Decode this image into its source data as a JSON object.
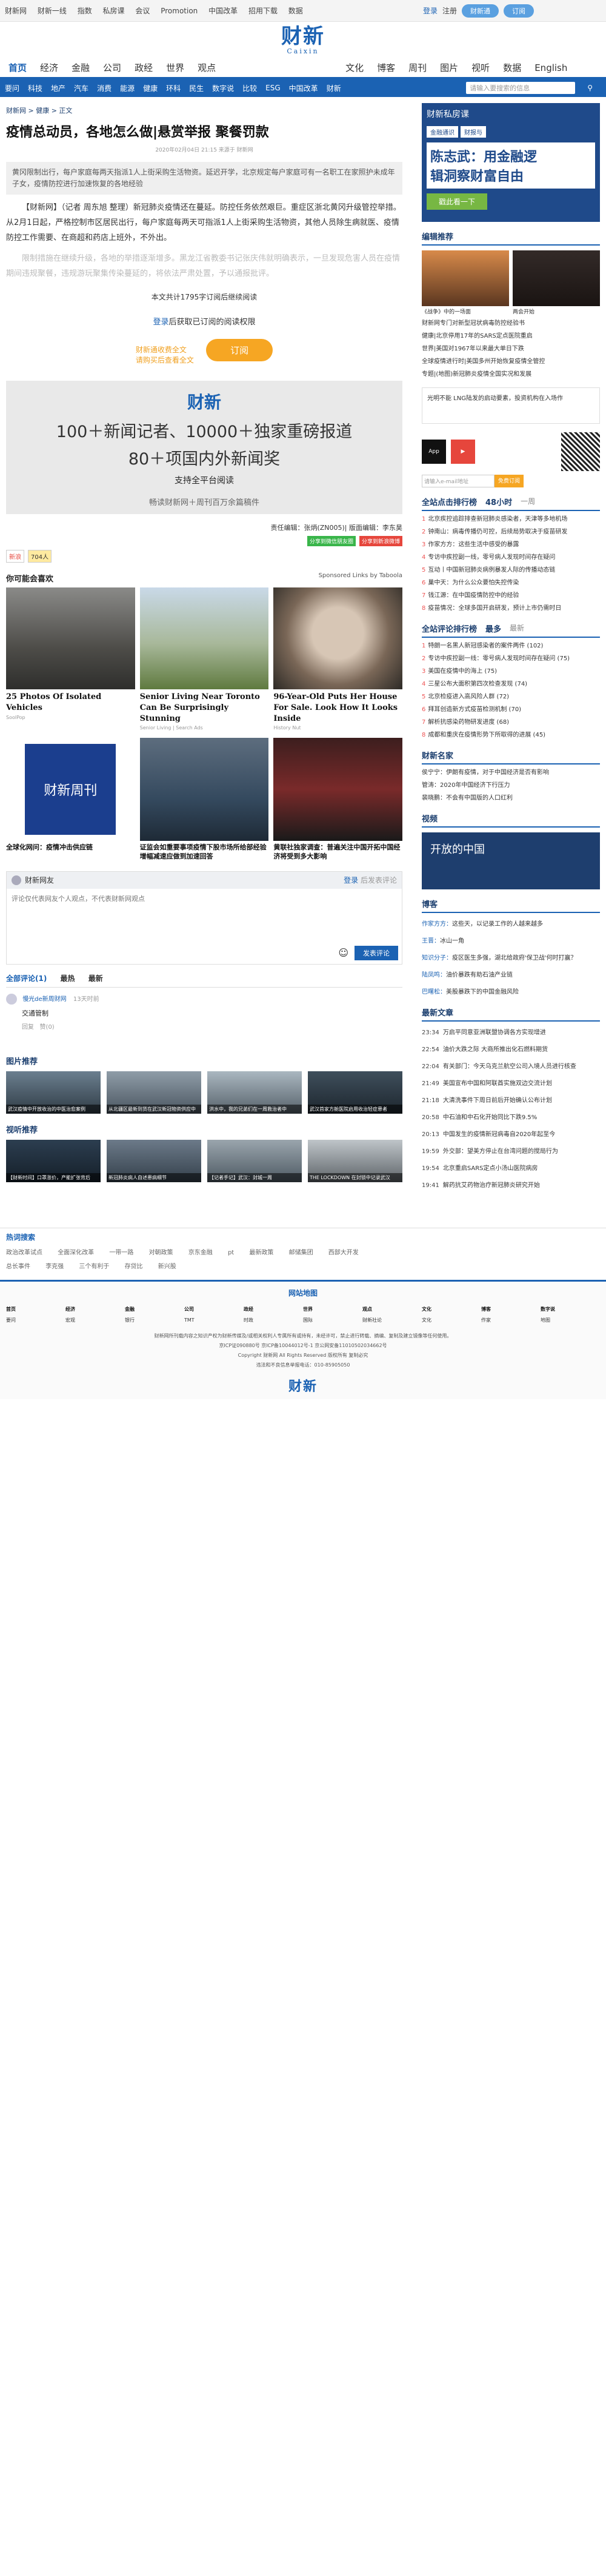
{
  "topbar": {
    "links": [
      "财新网",
      "财新一线",
      "指数",
      "私房课",
      "会议",
      "Promotion",
      "中国改革",
      "招用下载",
      "数据"
    ],
    "login": "登录",
    "register": "注册",
    "pill1": "财新通",
    "pill2": "订阅"
  },
  "logo": {
    "cn": "财新",
    "en": "Caixin"
  },
  "mainnav": {
    "left": [
      "首页",
      "经济",
      "金融",
      "公司",
      "政经",
      "世界",
      "观点"
    ],
    "right": [
      "文化",
      "博客",
      "周刊",
      "图片",
      "视听",
      "数据",
      "English"
    ]
  },
  "subnav": {
    "items": [
      "要问",
      "科技",
      "地产",
      "汽车",
      "消费",
      "能源",
      "健康",
      "环科",
      "民生",
      "数字说",
      "比较",
      "ESG",
      "中国改革",
      "财新"
    ],
    "search": "请输入要搜索的信息"
  },
  "article": {
    "breadcrumb": "财新网 > 健康 > 正文",
    "title": "疫情总动员，各地怎么做|悬赏举报 聚餐罚款",
    "meta": "2020年02月04日 21:15 来源于 财新网",
    "summary": "黄冈限制出行，每户家庭每两天指派1人上街采购生活物资。延迟开学，北京规定每户家庭可有一名职工在家照护未成年子女，疫情防控进行加速恢复的各地经验",
    "p1": "【财新网】（记者 周东旭 整理）新冠肺炎疫情还在蔓延。防控任务依然艰巨。重症区浙北黄冈升级管控举措。从2月1日起，严格控制市区居民出行，每户家庭每两天可指派1人上街采购生活物资，其他人员除生病就医、疫情防控工作需要、在商超和药店上班外，不外出。",
    "p2": "限制措施在继续升级，各地的举措逐渐增多。黑龙江省教委书记张庆伟就明确表示，一旦发现危害人员在疫情期间违规聚餐，违规游玩聚集传染蔓延的，将依法严肃处置，予以通报批评。",
    "note": "本文共计1795字订阅后继续阅读"
  },
  "paywall": {
    "login": "登录",
    "tip": "后获取已订阅的阅读权限",
    "sub1": "财新通收费全文",
    "sub2": "请购买后查看全文",
    "btn": "订阅"
  },
  "banner": {
    "logo": "财新",
    "l1": "100＋新闻记者、10000＋独家重磅报道",
    "l2": "80＋项国内外新闻奖",
    "l3": "支持全平台阅读",
    "l4": "畅读财新网＋周刊百万余篇稿件"
  },
  "editor": "责任编辑：张炳(ZN005)| 版面编辑：李东昊",
  "badges": [
    "分享到微信朋友圈",
    "分享到新浪微博"
  ],
  "share": [
    "新浪",
    "704人"
  ],
  "recommend": {
    "title": "你可能会喜欢",
    "sponsor": "Sponsored Links by Taboola",
    "cards": [
      {
        "h": "25 Photos Of Isolated Vehicles",
        "s": "SoolPop"
      },
      {
        "h": "Senior Living Near Toronto Can Be Surprisingly Stunning",
        "s": "Senior Living | Search Ads"
      },
      {
        "h": "96-Year-Old Puts Her House For Sale. Look How It Looks Inside",
        "s": "History Nut"
      }
    ],
    "small": [
      {
        "h": "全球化网问：疫情冲击供应链"
      },
      {
        "h": "证监会如重要事项疫情下股市场所给部经验增幅减速应做到加速回答"
      },
      {
        "h": "黄联社独家调查：普遍关注中国开拓中国经济将受到多大影响"
      }
    ]
  },
  "comment": {
    "label": "财新网友",
    "login": "登录",
    "logout": "后发表评论",
    "placeholder": "评论仅代表网友个人观点，不代表财新网观点",
    "send": "发表评论",
    "tabs": [
      "全部评论(1)",
      "最热",
      "最新"
    ],
    "user": "慢光de新周财网",
    "time": "13天时前",
    "text": "交通管制",
    "a1": "回复",
    "a2": "赞(0)"
  },
  "pictures": {
    "title": "图片推荐",
    "items": [
      "武汉疫情中开放收治的中医治愈案例",
      "从北疆区最新到货在武汉新冠物资供应中",
      "洪水中，我的兄弟们在一周救治者中",
      "武汉首家方舱医院启用收治轻症患者"
    ]
  },
  "videos": {
    "title": "视听推荐",
    "items": [
      "【财新时间】口罩涨价，产能扩张背后",
      "新冠肺炎病人自述患病细节",
      "【记者手记】武汉：封城一周",
      "THE LOCKDOWN 在封锁中记录武汉"
    ]
  },
  "right": {
    "ad": {
      "l1": "财新私房课",
      "tag1": "金融通识",
      "tag2": "财报与",
      "big1": "陈志武：用金融逻",
      "big2": "辑洞察财富自由",
      "btn": "戳此看一下"
    },
    "editor_title": "编辑推荐",
    "editor_imgs": [
      "《战争》中的一场面",
      "两会开始"
    ],
    "editor_list": [
      "财新网专门对新型冠状病毒防控经验书",
      "健康|北京停用17年的SARS定点医院重启",
      "世界|美国对1967年以来最大单日下跌",
      "全球疫情进行时|美国多州开始恢复疫情全管控",
      "专题|(地图)新冠肺炎疫情全国实况和发展"
    ],
    "promo": "光明不能 LNG陆发的启动要素，投资机构在入场作",
    "app": "App",
    "mail_placeholder": "请输入e-mail地址",
    "mail_btn": "免费订阅",
    "rank_title": "全站点击排行榜",
    "rank_tabs": [
      "48小时",
      "一周"
    ],
    "rank": [
      "北京疾控追踪排查新冠肺炎感染者，天津等多地机场",
      "钟南山：病毒传播仍可控，后续局势取决于疫苗研发",
      "作家方方：这些生活中感受的暴露",
      "专访中疾控副一线，零号病人发现时间存在疑问",
      "互动丨中国新冠肺炎病例暴发人际的传播动态链",
      "巢中天：为什么公众要怕失控传染",
      "钱江源：在中国疫情防控中的经验",
      "疫苗情况：全球多国开启研发，预计上市仍需时日"
    ],
    "rank2_title": "全站评论排行榜",
    "rank2_tabs": [
      "最多",
      "最新"
    ],
    "rank2": [
      "特朗一名黑人新冠感染者的案件两件 (102)",
      "专访中疾控副一线：零号病人发现时间存在疑问 (75)",
      "美国在疫情中的海上 (75)",
      "三星公布大面积第四次检查发现 (74)",
      "北京检疫进入高风险人群 (72)",
      "拜耳创造新方式疫苗检测机制 (70)",
      "解析抗感染药物研发进度 (68)",
      "成都和重庆在疫情形势下所取得的进展 (45)"
    ],
    "opinion_title": "财新名家",
    "opinion": [
      "侯宁宁：伊朗有疫情，对于中国经济是否有影响",
      "管涛：2020年中国经济下行压力",
      "裴晓鹏：不会有中国版的人口红利"
    ],
    "video_title": "视频",
    "video_text": "开放的中国",
    "blog_title": "博客",
    "blog": [
      [
        "作家方方：",
        "这些天，以记录工作的人越来越多"
      ],
      [
        "王晋：",
        "冰山一角"
      ],
      [
        "知识分子：",
        "疫区医生多强，湖北给政府'保卫战'何时打赢？"
      ],
      [
        "陆凤鸣：",
        "油价暴跌有助石油产业链"
      ],
      [
        "巴曙松：",
        "美股暴跌下的中国金融风险"
      ]
    ],
    "latest_title": "最新文章",
    "latest": [
      [
        "23:34",
        "万启平同意亚洲联盟协调各方实现增进"
      ],
      [
        "22:54",
        "油价大跌之际 大商所推出化石燃料期货"
      ],
      [
        "22:04",
        "有关部门：今天乌克兰航空公司入境人员进行核查"
      ],
      [
        "21:49",
        "美国宣布中国和阿联酋实施双边交流计划"
      ],
      [
        "21:18",
        "大清洗事件下周日前后开始确认公布计划"
      ],
      [
        "20:58",
        "中石油和中石化开始同比下跌9.5%"
      ],
      [
        "20:13",
        "中国发生的疫情新冠病毒自2020年起至今"
      ],
      [
        "19:59",
        "外交部：望美方停止在台湾问题的搅局行为"
      ],
      [
        "19:54",
        "北京重启SARS定点小汤山医院病房"
      ],
      [
        "19:41",
        "解药抗艾药物治疗新冠肺炎研究开始"
      ]
    ]
  },
  "hot": {
    "title": "热词搜索",
    "row1": [
      "政治改革试点",
      "全面深化改革",
      "一带一路",
      "对朝政策",
      "京东金融",
      "pt",
      "最新政策",
      "邮储集团",
      "西部大开发"
    ],
    "row2": [
      "总长事件",
      "李克强",
      "三个有利于",
      "存贷比",
      "新兴股"
    ]
  },
  "map": {
    "title": "网站地图",
    "heads": [
      "首页",
      "经济",
      "金融",
      "公司",
      "政经",
      "世界",
      "观点",
      "文化",
      "博客",
      "数字说"
    ],
    "sub": [
      "要问",
      "宏观",
      "银行",
      "TMT",
      "时政",
      "国际",
      "财新社论",
      "文化",
      "作家",
      "地图"
    ]
  },
  "footer": [
    "财新网所刊载内容之知识产权为财新传媒及/或相关权利人专属所有或持有，未经许可，禁止进行转载、摘编、复制及建立镜像等任何使用。",
    "京ICP证090880号 京ICP备10044012号-1 京公网安备11010502034662号",
    "Copyright 财新网 All Rights Reserved 版权所有 复制必究",
    "违法和不良信息举报电话：010-85905050"
  ]
}
